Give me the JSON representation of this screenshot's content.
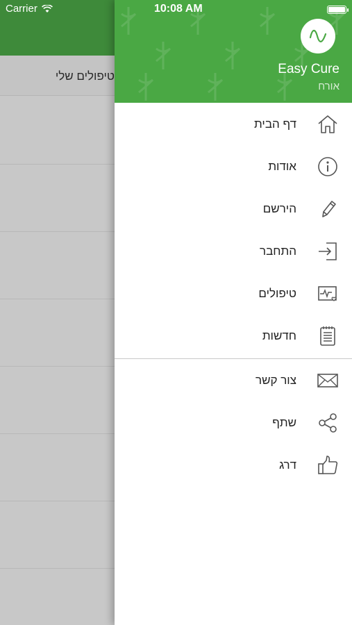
{
  "status_bar": {
    "carrier": "Carrier",
    "time": "10:08 AM"
  },
  "background_screen": {
    "subbar_title": "טיפולים שלי"
  },
  "drawer": {
    "app_name": "Easy Cure",
    "user_name": "אורח",
    "colors": {
      "header": "#4aa844",
      "background_header": "#3e8a3a"
    },
    "items": [
      {
        "label": "דף הבית",
        "icon": "home-icon"
      },
      {
        "label": "אודות",
        "icon": "info-icon"
      },
      {
        "label": "הירשם",
        "icon": "pencil-icon"
      },
      {
        "label": "התחבר",
        "icon": "login-icon"
      },
      {
        "label": "טיפולים",
        "icon": "health-monitor-icon"
      },
      {
        "label": "חדשות",
        "icon": "notepad-icon"
      }
    ],
    "secondary_items": [
      {
        "label": "צור קשר",
        "icon": "envelope-icon"
      },
      {
        "label": "שתף",
        "icon": "share-icon"
      },
      {
        "label": "דרג",
        "icon": "thumbs-up-icon"
      }
    ]
  }
}
